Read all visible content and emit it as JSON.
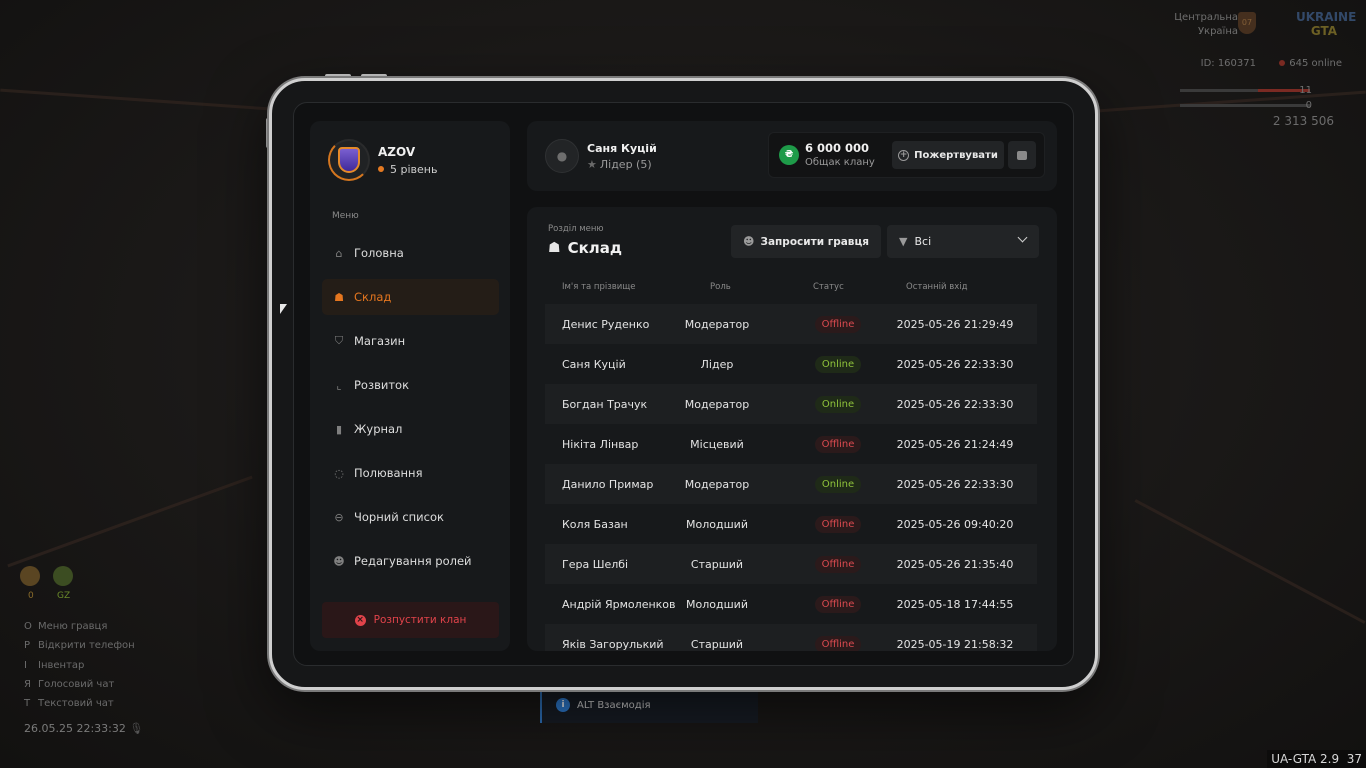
{
  "hud": {
    "region_line1": "Центральна",
    "region_line2": "Україна",
    "region_badge": "07",
    "logo_line1": "UKRAINE",
    "logo_line2": "GTA",
    "player_id": "ID: 160371",
    "online": "645 online",
    "health": "11",
    "armor": "0",
    "money": "2 313 506",
    "stat1": "0",
    "stat2": "GZ",
    "keys": [
      {
        "key": "O",
        "label": "Меню гравця"
      },
      {
        "key": "P",
        "label": "Відкрити телефон"
      },
      {
        "key": "I",
        "label": "Інвентар"
      },
      {
        "key": "Я",
        "label": "Голосовий чат"
      },
      {
        "key": "T",
        "label": "Текстовий чат"
      }
    ],
    "datetime": "26.05.25 22:33:32",
    "version": "UA-GTA 2.9",
    "fps": "37"
  },
  "hint": {
    "text": "ALT Взаємодія"
  },
  "clan": {
    "name": "AZOV",
    "level": "5 рівень"
  },
  "sidebar": {
    "menu_title": "Меню",
    "items": [
      {
        "label": "Головна",
        "icon": "home-icon",
        "glyph": "⌂"
      },
      {
        "label": "Склад",
        "icon": "users-icon",
        "glyph": "☗"
      },
      {
        "label": "Магазин",
        "icon": "basket-icon",
        "glyph": "⛉"
      },
      {
        "label": "Розвиток",
        "icon": "chart-icon",
        "glyph": "⌞"
      },
      {
        "label": "Журнал",
        "icon": "book-icon",
        "glyph": "▮"
      },
      {
        "label": "Полювання",
        "icon": "target-icon",
        "glyph": "◌"
      },
      {
        "label": "Чорний список",
        "icon": "block-icon",
        "glyph": "⊖"
      },
      {
        "label": "Редагування ролей",
        "icon": "user-edit-icon",
        "glyph": "☻"
      }
    ],
    "active_index": 1,
    "disband_label": "Розпустити клан"
  },
  "user": {
    "name": "Саня Куцій",
    "role": "Лідер (5)"
  },
  "bank": {
    "amount": "6 000 000",
    "label": "Общак клану",
    "donate_label": "Пожертвувати",
    "coin": "₴"
  },
  "section": {
    "label": "Розділ меню",
    "title": "Склад",
    "invite_label": "Запросити гравця",
    "filter_value": "Всі"
  },
  "table": {
    "headers": [
      "Ім'я та прізвище",
      "Роль",
      "Статус",
      "Останній вхід"
    ],
    "rows": [
      {
        "name": "Денис Руденко",
        "role": "Модератор",
        "status": "Offline",
        "last": "2025-05-26 21:29:49"
      },
      {
        "name": "Саня Куцій",
        "role": "Лідер",
        "status": "Online",
        "last": "2025-05-26 22:33:30"
      },
      {
        "name": "Богдан Трачук",
        "role": "Модератор",
        "status": "Online",
        "last": "2025-05-26 22:33:30"
      },
      {
        "name": "Нікіта Лінвар",
        "role": "Місцевий",
        "status": "Offline",
        "last": "2025-05-26 21:24:49"
      },
      {
        "name": "Данило Примар",
        "role": "Модератор",
        "status": "Online",
        "last": "2025-05-26 22:33:30"
      },
      {
        "name": "Коля Базан",
        "role": "Молодший",
        "status": "Offline",
        "last": "2025-05-26 09:40:20"
      },
      {
        "name": "Гера Шелбі",
        "role": "Старший",
        "status": "Offline",
        "last": "2025-05-26 21:35:40"
      },
      {
        "name": "Андрій Ярмоленков",
        "role": "Молодший",
        "status": "Offline",
        "last": "2025-05-18 17:44:55"
      },
      {
        "name": "Яків Загорулький",
        "role": "Старший",
        "status": "Offline",
        "last": "2025-05-19 21:58:32"
      }
    ]
  },
  "colors": {
    "accent": "#e5761f",
    "online": "#8fc23b",
    "offline": "#d94a4f",
    "coin": "#1e9b49"
  }
}
